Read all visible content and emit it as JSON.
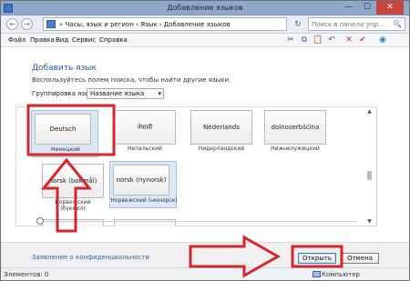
{
  "window": {
    "title": "Добавление языков",
    "controls": {
      "minimize": "—",
      "maximize": "☐",
      "close": "✕"
    }
  },
  "address": {
    "breadcrumb": "«  Часы, язык и регион  ›  Язык  ›  Добавление языков",
    "search_placeholder": "Поиск в панели упр...",
    "back_symbol": "←",
    "forward_symbol": "→",
    "refresh_symbol": "↻",
    "search_symbol": "🔍"
  },
  "menu": {
    "items": [
      "Файл",
      "Правка",
      "Вид",
      "Сервис",
      "Справка"
    ]
  },
  "toolbar": {
    "icons": [
      {
        "name": "cut-icon",
        "glyph": "✂",
        "color": "#3b4c66"
      },
      {
        "name": "copy-icon",
        "glyph": "⧉",
        "color": "#4a6b9b"
      },
      {
        "name": "paste-icon",
        "glyph": "📋",
        "color": "#b08a3e"
      },
      {
        "name": "undo-icon",
        "glyph": "↶",
        "color": "#3a7d3a"
      },
      {
        "name": "delete-icon",
        "glyph": "✕",
        "color": "#c0392b"
      },
      {
        "name": "check-icon",
        "glyph": "✔",
        "color": "#d24b20"
      },
      {
        "name": "globe-icon",
        "glyph": "◉",
        "color": "#2f84c8"
      }
    ]
  },
  "main": {
    "heading": "Добавить язык",
    "description": "Воспользуйтесь полем поиска, чтобы найти другие языки.",
    "group_label": "Группировка языков:",
    "group_value": "Название языка",
    "languages": [
      {
        "lang": "Deutsch",
        "name": "Немецкий",
        "selected": true
      },
      {
        "lang": "नेपाली",
        "name": "Непальский",
        "selected": false
      },
      {
        "lang": "Nederlands",
        "name": "Нидерландский",
        "selected": false
      },
      {
        "lang": "dolnoserbšćina",
        "name": "Нижнелужицкий",
        "selected": false
      },
      {
        "lang": "norsk (bokmål)",
        "name": "Норвежский (букмол)",
        "selected": false
      },
      {
        "lang": "norsk (nynorsk)",
        "name": "Норвежский (нюнорск)",
        "selected": true
      }
    ]
  },
  "bottom": {
    "privacy_link": "Заявление о конфиденциальности",
    "open_label": "Открыть",
    "cancel_label": "Отмена"
  },
  "status": {
    "items": "Элементов: 0",
    "location": "Компьютер"
  },
  "colors": {
    "annotation_red": "#d7262b",
    "link_blue": "#2b63ad",
    "heading_blue": "#1f5fa3"
  }
}
